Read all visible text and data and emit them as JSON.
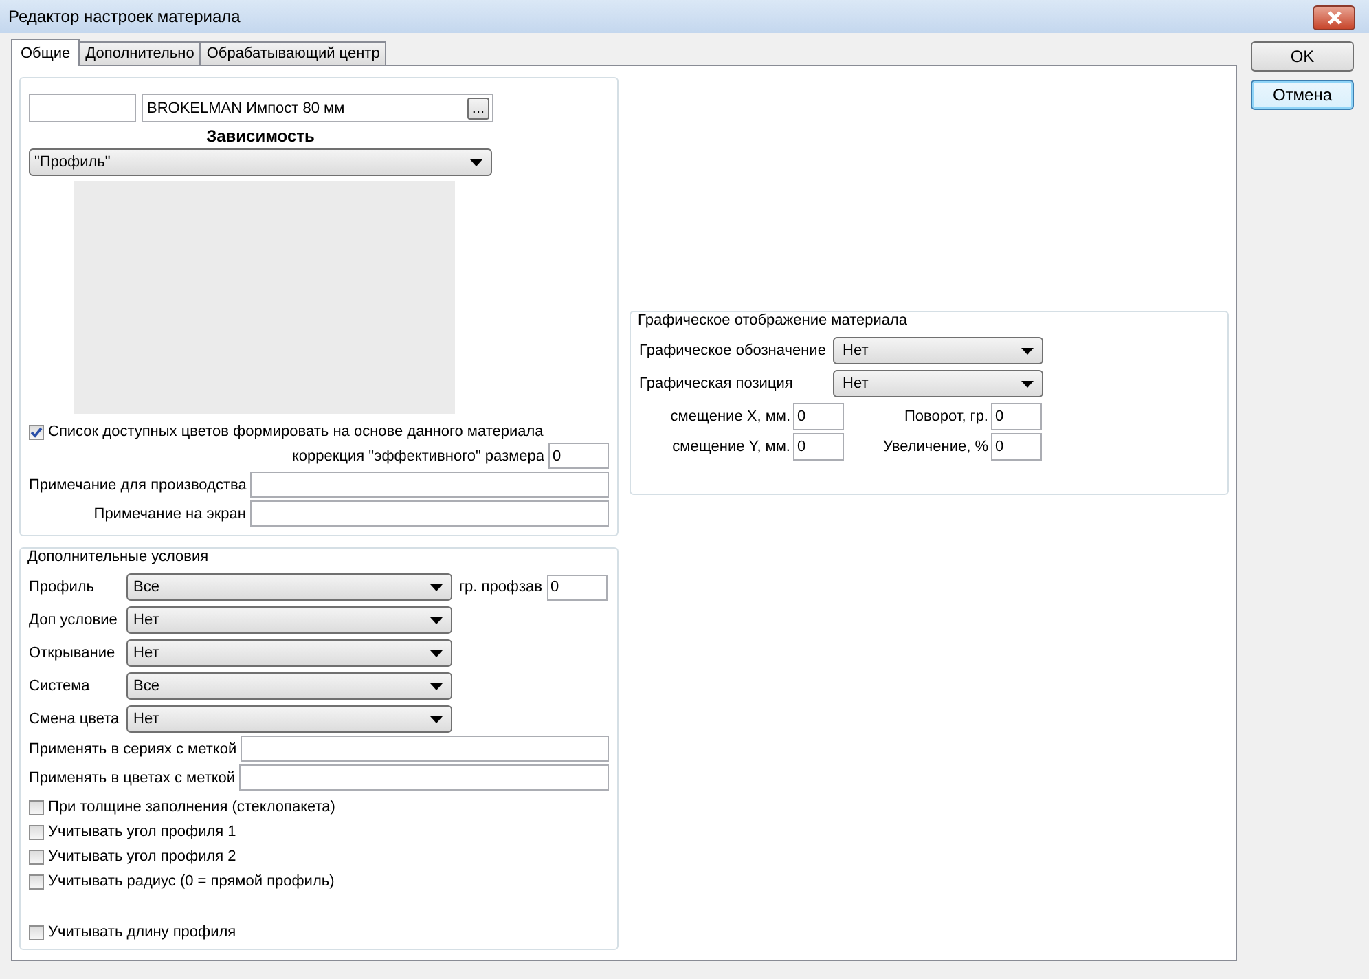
{
  "window": {
    "title": "Редактор настроек материала"
  },
  "tabs": [
    {
      "label": "Общие",
      "selected": true
    },
    {
      "label": "Дополнительно",
      "selected": false
    },
    {
      "label": "Обрабатывающий центр",
      "selected": false
    }
  ],
  "material": {
    "name": "BROKELMAN Импост 80 мм",
    "browse_button": "...",
    "dependency_label": "Зависимость",
    "dependency_value": "\"Профиль\""
  },
  "colors_checkbox": {
    "label": "Список доступных цветов формировать на основе данного материала",
    "checked": true
  },
  "size_correction": {
    "label": "коррекция \"эффективного\" размера",
    "value": "0"
  },
  "notes": [
    {
      "label": "Примечание для производства"
    },
    {
      "label": "Примечание на экран"
    }
  ],
  "conditions": {
    "legend": "Дополнительные условия",
    "selects": [
      {
        "label": "Профиль",
        "value": "Все"
      },
      {
        "label": "Доп условие",
        "value": "Нет"
      },
      {
        "label": "Открывание",
        "value": "Нет"
      },
      {
        "label": "Система",
        "value": "Все"
      },
      {
        "label": "Смена цвета",
        "value": "Нет"
      }
    ],
    "profile_group": {
      "label": "гр. профзав",
      "value": "0"
    },
    "tag_fields": [
      {
        "label": "Применять в сериях с меткой"
      },
      {
        "label": "Применять в цветах с меткой"
      }
    ],
    "checkboxes": [
      {
        "label": "При толщине заполнения (стеклопакета)",
        "checked": false
      },
      {
        "label": "Учитывать угол профиля 1",
        "checked": false
      },
      {
        "label": "Учитывать угол профиля 2",
        "checked": false
      },
      {
        "label": "Учитывать радиус (0 = прямой профиль)",
        "checked": false
      }
    ],
    "length_checkbox": {
      "label": "Учитывать длину профиля",
      "checked": false
    }
  },
  "graphic": {
    "legend": "Графическое отображение материала",
    "selects": [
      {
        "label": "Графическое обозначение",
        "value": "Нет"
      },
      {
        "label": "Графическая позиция",
        "value": "Нет"
      }
    ],
    "offsets": [
      {
        "label": "смещение X, мм.",
        "value": "0"
      },
      {
        "label": "Поворот, гр.",
        "value": "0"
      },
      {
        "label": "смещение Y, мм.",
        "value": "0"
      },
      {
        "label": "Увеличение, %",
        "value": "0"
      }
    ]
  },
  "buttons": [
    {
      "label": "OK",
      "focused": false
    },
    {
      "label": "Отмена",
      "focused": true
    }
  ]
}
